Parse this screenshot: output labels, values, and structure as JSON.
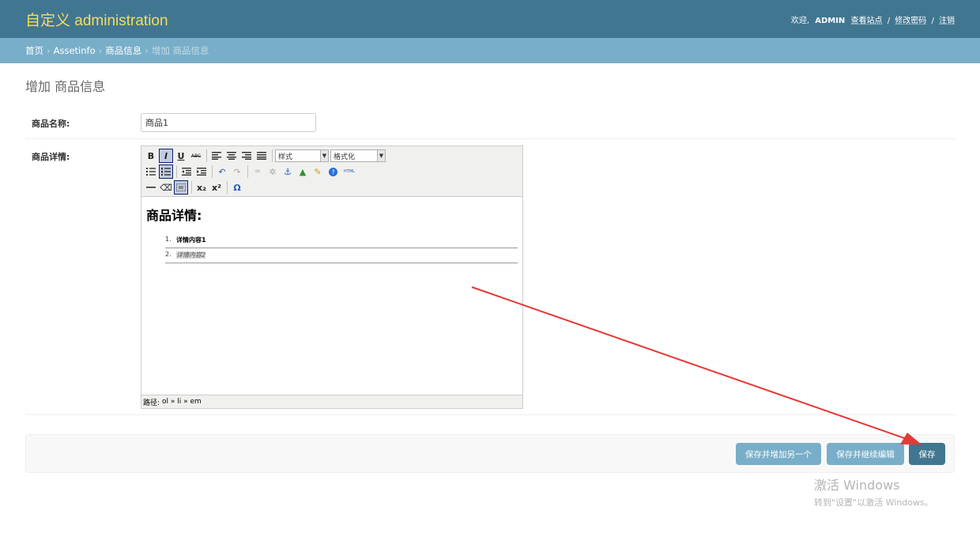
{
  "header": {
    "brand": "自定义 administration",
    "welcome": "欢迎,",
    "username": "ADMIN",
    "view_site": "查看站点",
    "change_password": "修改密码",
    "logout": "注销",
    "separator": "/",
    "bg_color": "#417690",
    "brand_color": "#f5dd5d"
  },
  "breadcrumbs": {
    "home": "首页",
    "app": "Assetinfo",
    "model": "商品信息",
    "current": "增加 商品信息",
    "arrow": "›"
  },
  "page": {
    "title": "增加 商品信息"
  },
  "form": {
    "name_label": "商品名称:",
    "name_value": "商品1",
    "detail_label": "商品详情:"
  },
  "editor": {
    "style_select": "样式",
    "format_select": "格式化",
    "content_heading": "商品详情:",
    "list_items": [
      {
        "num": "1.",
        "text": "详情内容1"
      },
      {
        "num": "2.",
        "text": "详情内容2"
      }
    ],
    "path_label": "路径:",
    "path_value": "ol » li » em",
    "icons": {
      "bold": "B",
      "italic": "I",
      "underline": "U",
      "strike": "ABC",
      "subscript": "x₂",
      "superscript": "x²",
      "charmap": "Ω",
      "html": "HTML"
    }
  },
  "buttons": {
    "save_add_another": "保存并增加另一个",
    "save_continue": "保存并继续编辑",
    "save": "保存"
  },
  "watermark": {
    "title": "激活 Windows",
    "subtitle": "转到\"设置\"以激活 Windows。"
  },
  "annotation": {
    "arrow_color": "#e53935"
  }
}
